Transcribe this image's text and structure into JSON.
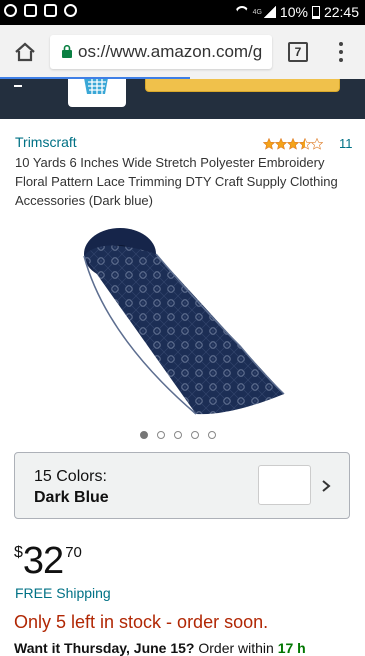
{
  "status_bar": {
    "battery": "10%",
    "time": "22:45",
    "network": "4G"
  },
  "browser": {
    "url": "os://www.amazon.com/g",
    "tab_count": "7"
  },
  "product": {
    "brand": "Trimscraft",
    "rating_stars": 3.5,
    "rating_count": "11",
    "title": "10 Yards 6 Inches Wide Stretch Polyester Embroidery Floral Pattern Lace Trimming DTY Craft Supply Clothing Accessories (Dark blue)",
    "image_dots": 5,
    "active_dot": 0
  },
  "color_selector": {
    "count_label": "15 Colors:",
    "selected": "Dark Blue"
  },
  "price": {
    "symbol": "$",
    "whole": "32",
    "fraction": "70"
  },
  "shipping": "FREE Shipping",
  "stock": "Only 5 left in stock - order soon.",
  "delivery_cutoff": {
    "prefix": "Want it Thursday, June 15?",
    "middle": " Order within ",
    "time": "17 h"
  },
  "colors": {
    "link": "#007185",
    "stock": "#b12704",
    "accent": "#f0c14b",
    "header": "#232f3e"
  }
}
